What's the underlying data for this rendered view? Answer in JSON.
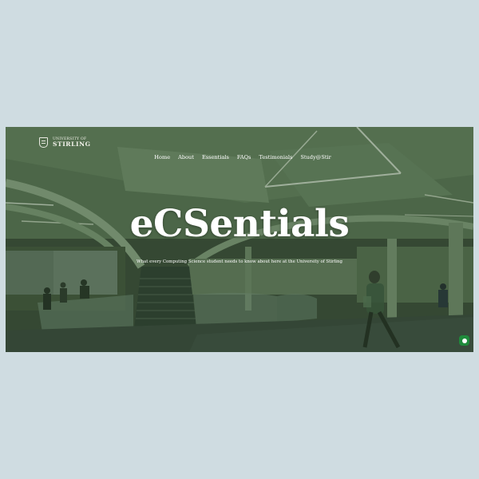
{
  "logo": {
    "line1": "UNIVERSITY OF",
    "line2": "STIRLING"
  },
  "nav": {
    "items": [
      "Home",
      "About",
      "Essentials",
      "FAQs",
      "Testimonials",
      "Study@Stir"
    ]
  },
  "hero": {
    "title": "eCSentials",
    "subtitle": "What every Computing Science student needs to know about here at the University of Stirling"
  },
  "chat": {
    "icon": "chat-bubble-icon",
    "color": "#1f8a3b"
  },
  "colors": {
    "page_background": "#cfdce1",
    "hero_tint": "#2d4628"
  }
}
